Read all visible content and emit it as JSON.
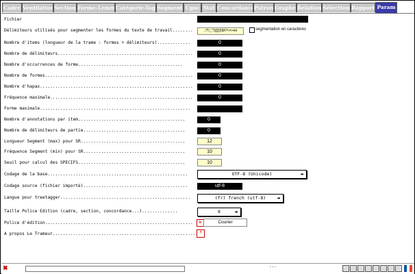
{
  "tabs": [
    "Cadre",
    "Ventilation",
    "Section",
    "Forme-Lemme",
    "Catégorie-Tag",
    "Segment",
    "Cgoc",
    "Stat",
    "Concordance",
    "Patron",
    "Graphe",
    "Relation",
    "Sélection",
    "Rapport",
    "Param"
  ],
  "active_tab": "Param",
  "fields": {
    "fichier": {
      "label": "Fichier",
      "value": ""
    },
    "delimiteurs": {
      "label": "Délimiteurs utilisés pour segmenter les formes du texte de travail",
      "value": ".;?!/_'\"()[]{}§$#?<=>éè"
    },
    "segmentation_caracteres": {
      "label": "segmentation en caractères",
      "checked": false
    },
    "nb_items": {
      "label": "Nombre d'items (longueur de la trame : formes + délimiteurs)",
      "value": "0"
    },
    "nb_delimiteurs": {
      "label": "Nombre de délimiteurs",
      "value": "0"
    },
    "nb_occurrences": {
      "label": "Nombre d'occurrences de forme",
      "value": "0"
    },
    "nb_formes": {
      "label": "Nombre de formes",
      "value": "0"
    },
    "nb_hapax": {
      "label": "Nombre d'hapax",
      "value": "0"
    },
    "freq_max": {
      "label": "Fréquence maximale",
      "value": "0"
    },
    "forme_max": {
      "label": "Forme maximale",
      "value": ""
    },
    "nb_annotations": {
      "label": "Nombre d'annotations par item",
      "value": "0"
    },
    "nb_delim_partie": {
      "label": "Nombre de délimiteurs de partie",
      "value": "0"
    },
    "seg_max": {
      "label": "Longueur Segment (max) pour SR",
      "value": "12"
    },
    "seg_min": {
      "label": "Fréquence Segment (min) pour SR",
      "value": "10"
    },
    "seuil_specifs": {
      "label": "Seuil pour calcul des SPECIFS",
      "value": "10"
    },
    "codage_base": {
      "label": "Codage de la base",
      "value": "UTF-8 (Unicode)"
    },
    "codage_source": {
      "label": "Codage source (fichier importé)",
      "value": "utf-8"
    },
    "langue_treetagger": {
      "label": "Langue pour treetagger",
      "value": "(fr) french (utf-8)"
    },
    "taille_police": {
      "label": "Taille Police Edition (cadre, section, concordance...)",
      "value": "8"
    },
    "police_edition": {
      "label": "Police d'édition",
      "value": "Courier"
    },
    "a_propos": {
      "label": "A propos Le Trameur"
    }
  },
  "status": {
    "dots": "..."
  },
  "icons": [
    "close-icon",
    "progress-bar",
    "toolbar-icons",
    "flag-icon"
  ]
}
